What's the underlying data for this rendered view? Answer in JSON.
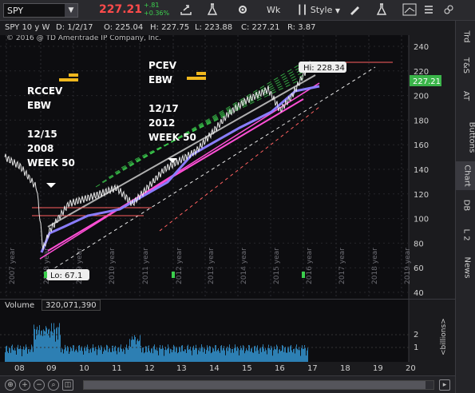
{
  "toolbar": {
    "symbol": "SPY",
    "dropdown_arrow": "▼",
    "last_price": "227.21",
    "change": "+.81",
    "change_pct": "+0.36%",
    "period_button": "Wk",
    "style_button": "Style"
  },
  "header": {
    "title": "SPY 10 y W",
    "date": "D: 1/2/17",
    "open": "O: 225.04",
    "high": "H: 227.75",
    "low": "L: 223.88",
    "close": "C: 227.21",
    "range": "R: 3.87"
  },
  "chart": {
    "copyright": "© 2016 @ TD Ameritrade IP Company, Inc.",
    "hi_label": "Hi: 228.34",
    "lo_label": "Lo: 67.1",
    "last_price_tag": "227.21",
    "ann_left_1": "RCCEV",
    "ann_left_2": "EBW",
    "ann_left_3": "12/15",
    "ann_left_4": "2008",
    "ann_left_5": "WEEK 50",
    "ann_right_1": "PCEV",
    "ann_right_2": "EBW",
    "ann_right_3": "12/17",
    "ann_right_4": "2012",
    "ann_right_5": "WEEK 50",
    "y_ticks": [
      "240",
      "220",
      "200",
      "180",
      "160",
      "140",
      "120",
      "100",
      "80",
      "60",
      "40"
    ],
    "year_labels": [
      "2007 year",
      "2008 year",
      "2009 year",
      "2010 year",
      "2011 year",
      "2012 year",
      "2013 year",
      "2014 year",
      "2015 year",
      "2016 year",
      "2017 year",
      "2018 year",
      "2019 year"
    ]
  },
  "volume": {
    "label": "Volume",
    "value": "320,071,390",
    "y_ticks": [
      "2",
      "1"
    ],
    "unit_label": "<billions>"
  },
  "x_axis": [
    "08",
    "09",
    "10",
    "11",
    "12",
    "13",
    "14",
    "15",
    "16",
    "17",
    "18",
    "19",
    "20"
  ],
  "side_tabs": [
    "Trd",
    "T&S",
    "AT",
    "Buttons",
    "Chart",
    "DB",
    "L 2",
    "News"
  ],
  "colors": {
    "up": "#3ccf4e",
    "down": "#ff4b4b",
    "price_line": "#e8e8e8",
    "channel": "#ff4fd6",
    "trend": "#8a7dff",
    "tag": "#3bb54a"
  }
}
